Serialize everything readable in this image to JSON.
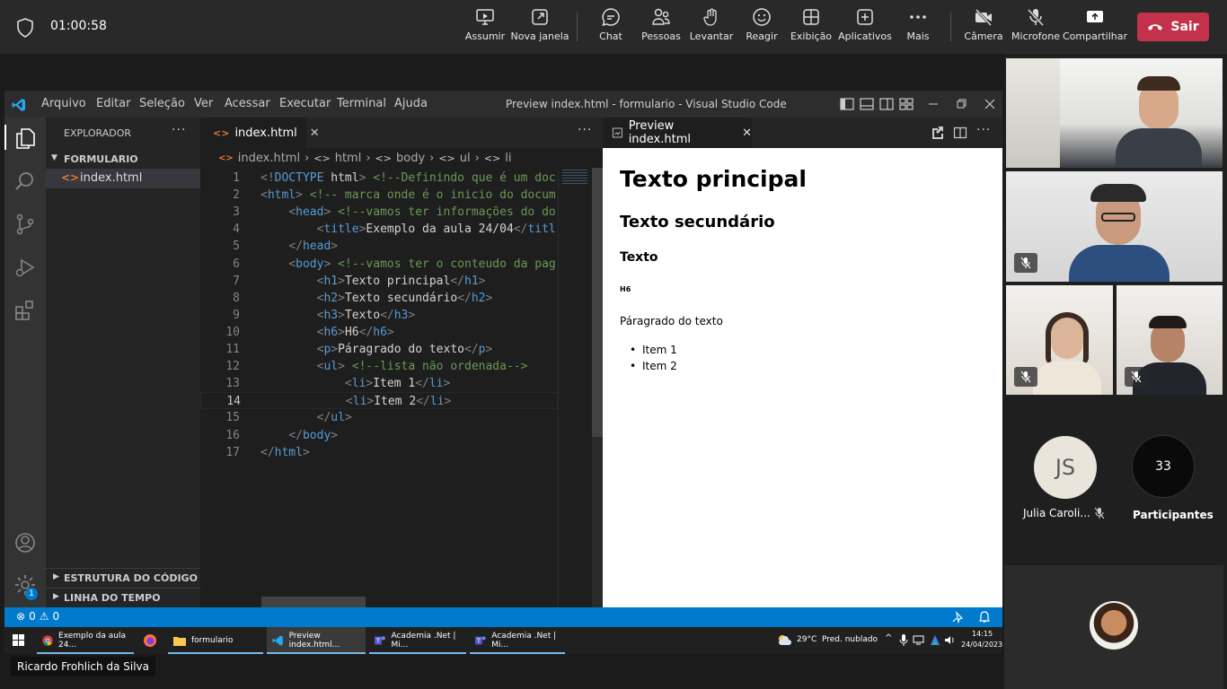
{
  "teams": {
    "timer": "01:00:58",
    "buttons": {
      "assumir": "Assumir",
      "nova_janela": "Nova janela",
      "chat": "Chat",
      "pessoas": "Pessoas",
      "levantar": "Levantar",
      "reagir": "Reagir",
      "exibicao": "Exibição",
      "aplicativos": "Aplicativos",
      "mais": "Mais",
      "camera": "Câmera",
      "microfone": "Microfone",
      "compartilhar": "Compartilhar"
    },
    "leave_label": "Sair",
    "leave_color": "#c4314b",
    "presenter_name": "Ricardo Frohlich da Silva",
    "participant_js_initials": "JS",
    "participant_js_name": "Julia Caroli...",
    "participants_count": "33",
    "participants_label": "Participantes"
  },
  "vscode": {
    "menu": [
      "Arquivo",
      "Editar",
      "Seleção",
      "Ver",
      "Acessar",
      "Executar",
      "Terminal",
      "Ajuda"
    ],
    "window_title": "Preview index.html - formulario - Visual Studio Code",
    "explorer_title": "EXPLORADOR",
    "folder_name": "FORMULARIO",
    "file_name": "index.html",
    "outline_label": "ESTRUTURA DO CÓDIGO",
    "timeline_label": "LINHA DO TEMPO",
    "editor_tab": "index.html",
    "breadcrumb": [
      "index.html",
      "html",
      "body",
      "ul",
      "li"
    ],
    "preview_tab": "Preview index.html",
    "status_errors": "0",
    "status_warnings": "0",
    "settings_badge": "1",
    "accent_color": "#007acc",
    "code_lines": [
      {
        "n": "1",
        "parts": [
          [
            "br",
            "<!"
          ],
          [
            "tg",
            "DOCTYPE "
          ],
          [
            "tx",
            "html"
          ],
          [
            "br",
            "> "
          ],
          [
            "cm",
            "<!--Definindo que é um documento"
          ]
        ]
      },
      {
        "n": "2",
        "parts": [
          [
            "br",
            "<"
          ],
          [
            "tg",
            "html"
          ],
          [
            "br",
            "> "
          ],
          [
            "cm",
            "<!-- marca onde é o inicio do documento"
          ]
        ]
      },
      {
        "n": "3",
        "parts": [
          [
            "tx",
            "    "
          ],
          [
            "br",
            "<"
          ],
          [
            "tg",
            "head"
          ],
          [
            "br",
            "> "
          ],
          [
            "cm",
            "<!--vamos ter informações do documento"
          ]
        ]
      },
      {
        "n": "4",
        "parts": [
          [
            "tx",
            "        "
          ],
          [
            "br",
            "<"
          ],
          [
            "tg",
            "title"
          ],
          [
            "br",
            ">"
          ],
          [
            "tx",
            "Exemplo da aula 24/04"
          ],
          [
            "br",
            "</"
          ],
          [
            "tg",
            "title"
          ],
          [
            "br",
            ">"
          ]
        ]
      },
      {
        "n": "5",
        "parts": [
          [
            "tx",
            "    "
          ],
          [
            "br",
            "</"
          ],
          [
            "tg",
            "head"
          ],
          [
            "br",
            ">"
          ]
        ]
      },
      {
        "n": "6",
        "parts": [
          [
            "tx",
            "    "
          ],
          [
            "br",
            "<"
          ],
          [
            "tg",
            "body"
          ],
          [
            "br",
            "> "
          ],
          [
            "cm",
            "<!--vamos ter o conteudo da pagina"
          ]
        ]
      },
      {
        "n": "7",
        "parts": [
          [
            "tx",
            "        "
          ],
          [
            "br",
            "<"
          ],
          [
            "tg",
            "h1"
          ],
          [
            "br",
            ">"
          ],
          [
            "tx",
            "Texto principal"
          ],
          [
            "br",
            "</"
          ],
          [
            "tg",
            "h1"
          ],
          [
            "br",
            ">"
          ]
        ]
      },
      {
        "n": "8",
        "parts": [
          [
            "tx",
            "        "
          ],
          [
            "br",
            "<"
          ],
          [
            "tg",
            "h2"
          ],
          [
            "br",
            ">"
          ],
          [
            "tx",
            "Texto secundário"
          ],
          [
            "br",
            "</"
          ],
          [
            "tg",
            "h2"
          ],
          [
            "br",
            ">"
          ]
        ]
      },
      {
        "n": "9",
        "parts": [
          [
            "tx",
            "        "
          ],
          [
            "br",
            "<"
          ],
          [
            "tg",
            "h3"
          ],
          [
            "br",
            ">"
          ],
          [
            "tx",
            "Texto"
          ],
          [
            "br",
            "</"
          ],
          [
            "tg",
            "h3"
          ],
          [
            "br",
            ">"
          ]
        ]
      },
      {
        "n": "10",
        "parts": [
          [
            "tx",
            "        "
          ],
          [
            "br",
            "<"
          ],
          [
            "tg",
            "h6"
          ],
          [
            "br",
            ">"
          ],
          [
            "tx",
            "H6"
          ],
          [
            "br",
            "</"
          ],
          [
            "tg",
            "h6"
          ],
          [
            "br",
            ">"
          ]
        ]
      },
      {
        "n": "11",
        "parts": [
          [
            "tx",
            "        "
          ],
          [
            "br",
            "<"
          ],
          [
            "tg",
            "p"
          ],
          [
            "br",
            ">"
          ],
          [
            "tx",
            "Páragrado do texto"
          ],
          [
            "br",
            "</"
          ],
          [
            "tg",
            "p"
          ],
          [
            "br",
            ">"
          ]
        ]
      },
      {
        "n": "12",
        "parts": [
          [
            "tx",
            "        "
          ],
          [
            "br",
            "<"
          ],
          [
            "tg",
            "ul"
          ],
          [
            "br",
            "> "
          ],
          [
            "cm",
            "<!--lista não ordenada-->"
          ]
        ]
      },
      {
        "n": "13",
        "parts": [
          [
            "tx",
            "            "
          ],
          [
            "br",
            "<"
          ],
          [
            "tg",
            "li"
          ],
          [
            "br",
            ">"
          ],
          [
            "tx",
            "Item 1"
          ],
          [
            "br",
            "</"
          ],
          [
            "tg",
            "li"
          ],
          [
            "br",
            ">"
          ]
        ]
      },
      {
        "n": "14",
        "parts": [
          [
            "tx",
            "            "
          ],
          [
            "br",
            "<"
          ],
          [
            "tg",
            "li"
          ],
          [
            "br",
            ">"
          ],
          [
            "tx",
            "Item 2"
          ],
          [
            "br",
            "</"
          ],
          [
            "tg",
            "li"
          ],
          [
            "br",
            ">"
          ]
        ]
      },
      {
        "n": "15",
        "parts": [
          [
            "tx",
            "        "
          ],
          [
            "br",
            "</"
          ],
          [
            "tg",
            "ul"
          ],
          [
            "br",
            ">"
          ]
        ]
      },
      {
        "n": "16",
        "parts": [
          [
            "tx",
            "    "
          ],
          [
            "br",
            "</"
          ],
          [
            "tg",
            "body"
          ],
          [
            "br",
            ">"
          ]
        ]
      },
      {
        "n": "17",
        "parts": [
          [
            "br",
            "</"
          ],
          [
            "tg",
            "html"
          ],
          [
            "br",
            ">"
          ]
        ]
      }
    ],
    "preview": {
      "h1": "Texto principal",
      "h2": "Texto secundário",
      "h3": "Texto",
      "h6": "H6",
      "p": "Páragrado do texto",
      "items": [
        "Item 1",
        "Item 2"
      ]
    }
  },
  "taskbar": {
    "tasks": [
      "Exemplo da aula 24...",
      "formulario",
      "Preview index.html...",
      "Academia .Net | Mi...",
      "Academia .Net | Mi..."
    ],
    "weather": "29°C  Pred. nublado",
    "time": "14:15",
    "date": "24/04/2023"
  }
}
